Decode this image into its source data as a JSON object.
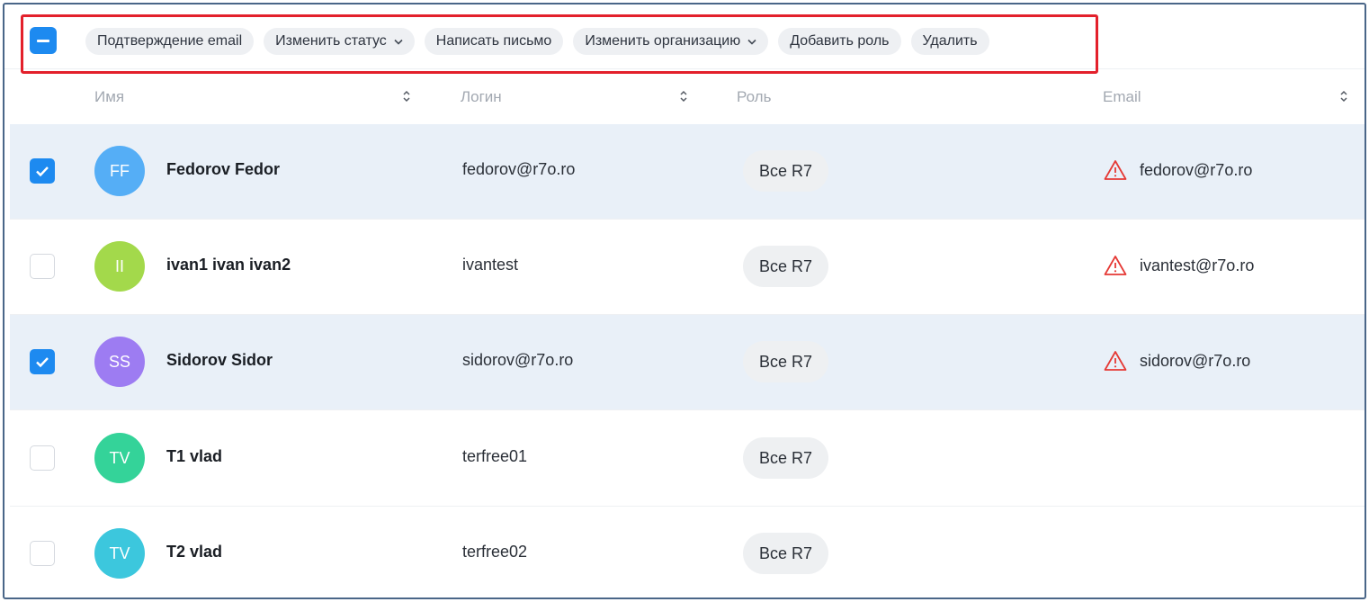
{
  "toolbar": {
    "actions": [
      {
        "label": "Подтверждение email",
        "dropdown": false
      },
      {
        "label": "Изменить статус",
        "dropdown": true
      },
      {
        "label": "Написать письмо",
        "dropdown": false
      },
      {
        "label": "Изменить организацию",
        "dropdown": true
      },
      {
        "label": "Добавить роль",
        "dropdown": false
      },
      {
        "label": "Удалить",
        "dropdown": false
      }
    ],
    "select_all_state": "indeterminate"
  },
  "columns": {
    "name": "Имя",
    "login": "Логин",
    "role": "Роль",
    "email": "Email"
  },
  "rows": [
    {
      "initials": "FF",
      "avatar_color": "#55aef6",
      "name": "Fedorov Fedor",
      "login": "fedorov@r7o.ro",
      "role": "Все R7",
      "email": "fedorov@r7o.ro",
      "email_warning": true,
      "selected": true
    },
    {
      "initials": "II",
      "avatar_color": "#a3d94b",
      "name": "ivan1 ivan ivan2",
      "login": "ivantest",
      "role": "Все R7",
      "email": "ivantest@r7o.ro",
      "email_warning": true,
      "selected": false
    },
    {
      "initials": "SS",
      "avatar_color": "#9d7cf2",
      "name": "Sidorov Sidor",
      "login": "sidorov@r7o.ro",
      "role": "Все R7",
      "email": "sidorov@r7o.ro",
      "email_warning": true,
      "selected": true
    },
    {
      "initials": "TV",
      "avatar_color": "#34d399",
      "name": "T1 vlad",
      "login": "terfree01",
      "role": "Все R7",
      "email": "",
      "email_warning": false,
      "selected": false
    },
    {
      "initials": "TV",
      "avatar_color": "#3cc7dd",
      "name": "T2 vlad",
      "login": "terfree02",
      "role": "Все R7",
      "email": "",
      "email_warning": false,
      "selected": false
    }
  ],
  "colors": {
    "accent": "#1d8af0",
    "selected_row": "#e9f0f8",
    "warning": "#e53935",
    "highlight_border": "#e3202b"
  }
}
